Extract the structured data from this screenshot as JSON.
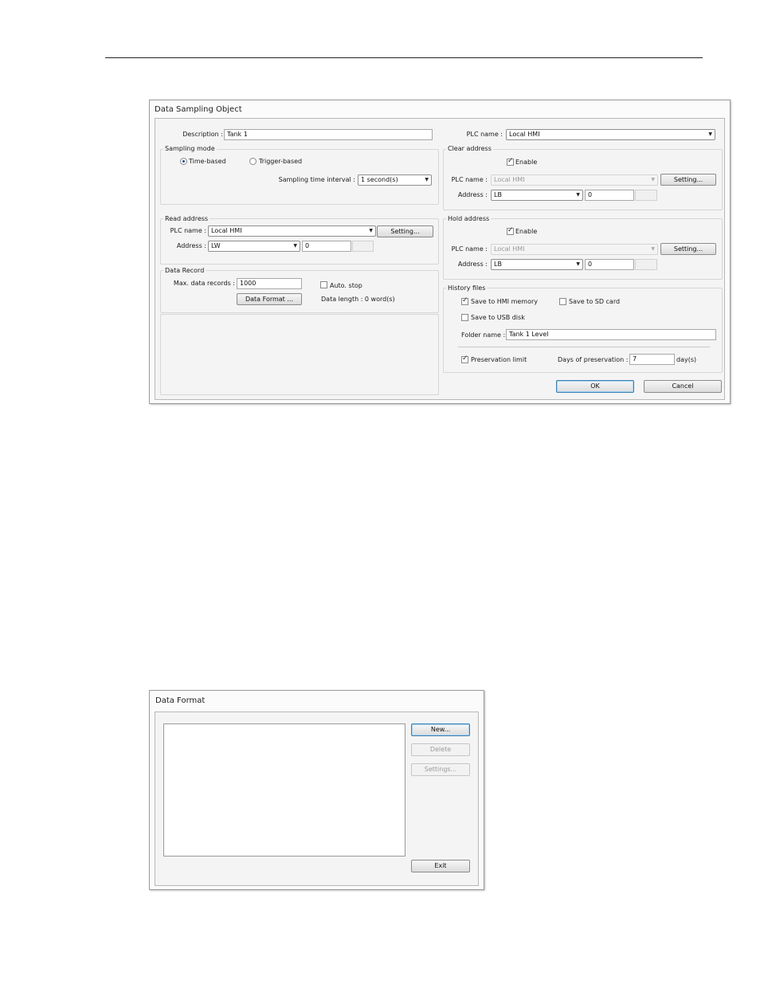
{
  "sampling": {
    "title": "Data Sampling Object",
    "description_label": "Description :",
    "description_value": "Tank 1",
    "plc_label": "PLC name :",
    "plc_value": "Local HMI",
    "sampling_mode": {
      "title": "Sampling mode",
      "time_based": "Time-based",
      "trigger_based": "Trigger-based",
      "selected": "Time-based",
      "interval_label": "Sampling time interval :",
      "interval_value": "1 second(s)"
    },
    "read_address": {
      "title": "Read address",
      "plc_label": "PLC name :",
      "plc_value": "Local HMI",
      "setting": "Setting...",
      "address_label": "Address :",
      "address_type": "LW",
      "address_value": "0"
    },
    "data_record": {
      "title": "Data Record",
      "max_label": "Max. data records :",
      "max_value": "1000",
      "auto_stop": "Auto. stop",
      "data_format_button": "Data Format ...",
      "data_length": "Data length : 0 word(s)"
    },
    "clear_address": {
      "title": "Clear address",
      "enable": "Enable",
      "plc_label": "PLC name :",
      "plc_value": "Local HMI",
      "setting": "Setting...",
      "address_label": "Address :",
      "address_type": "LB",
      "address_value": "0"
    },
    "hold_address": {
      "title": "Hold address",
      "enable": "Enable",
      "plc_label": "PLC name :",
      "plc_value": "Local HMI",
      "setting": "Setting...",
      "address_label": "Address :",
      "address_type": "LB",
      "address_value": "0"
    },
    "history_files": {
      "title": "History files",
      "save_hmi": "Save to HMI memory",
      "save_sd": "Save to SD card",
      "save_usb": "Save to USB disk",
      "folder_label": "Folder name :",
      "folder_value": "Tank 1 Level",
      "preservation_limit": "Preservation limit",
      "days_label": "Days of preservation :",
      "days_value": "7",
      "days_unit": "day(s)"
    },
    "ok": "OK",
    "cancel": "Cancel"
  },
  "format": {
    "title": "Data Format",
    "new": "New...",
    "delete": "Delete",
    "settings": "Settings...",
    "exit": "Exit"
  }
}
